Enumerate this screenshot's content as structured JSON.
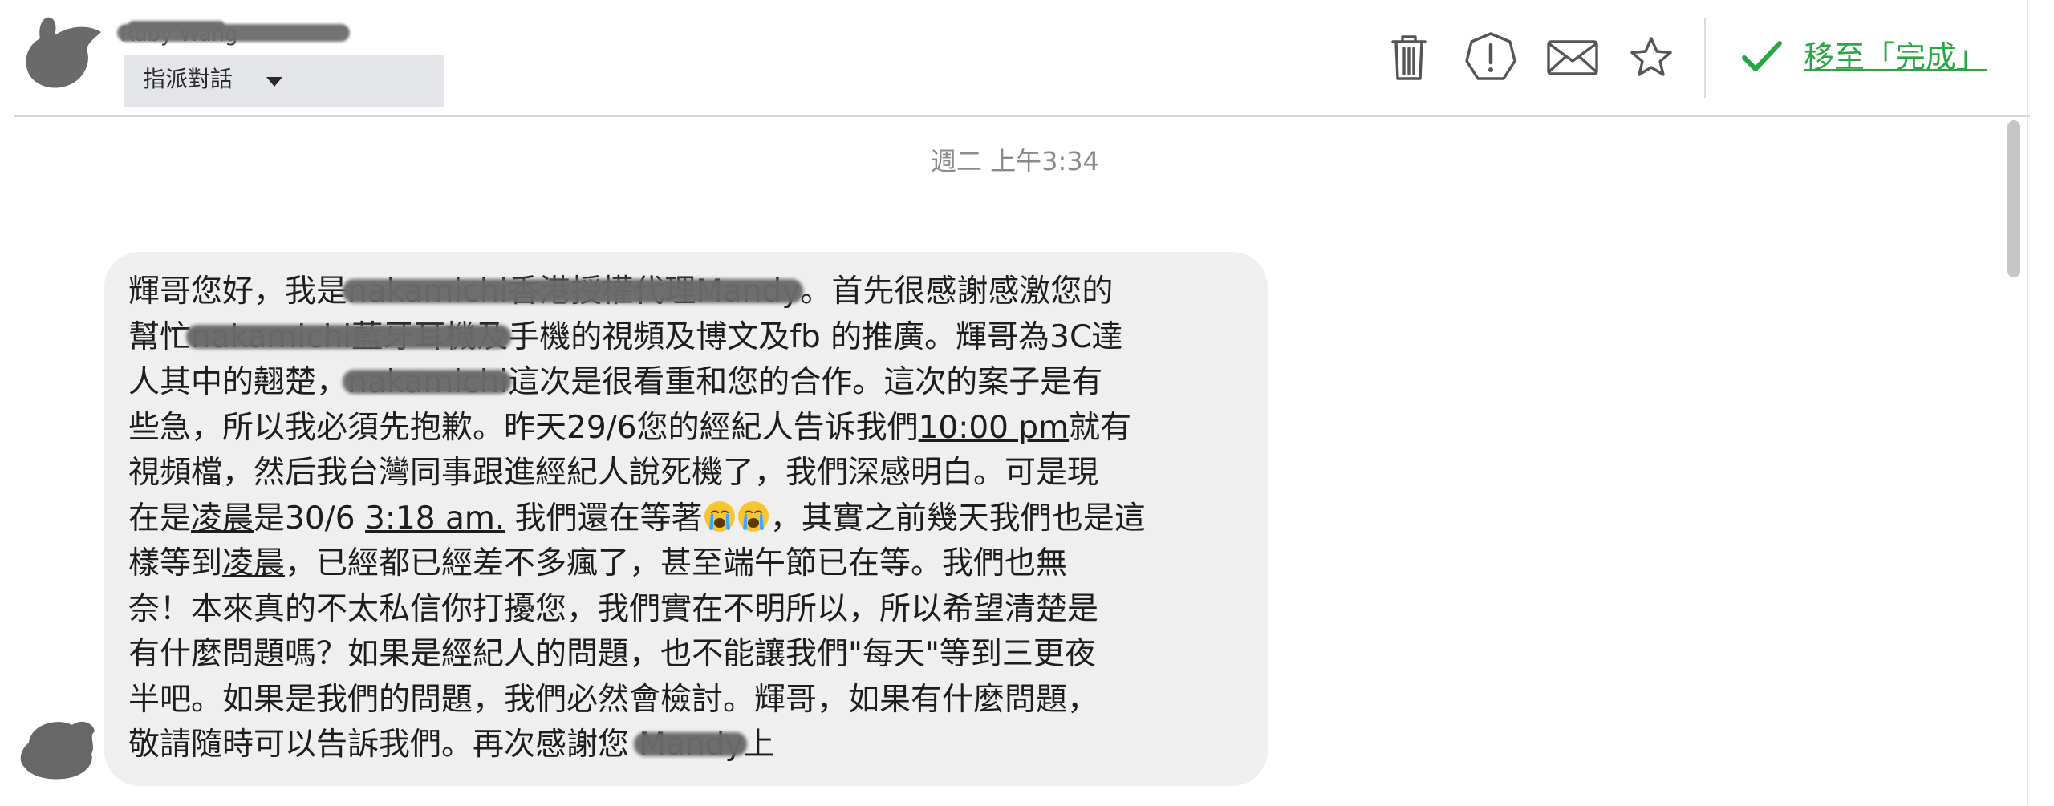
{
  "header": {
    "sender_name": "Ruby Wang",
    "assign_label": "指派對話",
    "actions": {
      "delete_icon": "trash-icon",
      "spam_icon": "exclamation-icon",
      "unread_icon": "envelope-icon",
      "star_icon": "star-icon"
    },
    "done_label": "移至「完成」"
  },
  "thread": {
    "timestamp": "週二 上午3:34",
    "message_lines": [
      [
        {
          "t": "輝哥您好，我是"
        },
        {
          "t": "nakamichi香港授權代理Mandy",
          "r": true
        },
        {
          "t": "。首先很感謝感激您的"
        }
      ],
      [
        {
          "t": "幫忙"
        },
        {
          "t": "nakamichi藍牙耳機及",
          "r": true
        },
        {
          "t": "手機的視頻及博文及fb 的推廣。輝哥為3C達"
        }
      ],
      [
        {
          "t": "人其中的翹楚，"
        },
        {
          "t": "nakamichi",
          "r": true
        },
        {
          "t": "這次是很看重和您的合作。這次的案子是有"
        }
      ],
      [
        {
          "t": "些急，所以我必須先抱歉。昨天29/6您的經紀人告诉我們"
        },
        {
          "t": "10:00 pm",
          "u": true
        },
        {
          "t": "就有"
        }
      ],
      [
        {
          "t": "視頻檔，然后我台灣同事跟進經紀人說死機了，我們深感明白。可是現"
        }
      ],
      [
        {
          "t": "在是"
        },
        {
          "t": "凌晨",
          "u": true
        },
        {
          "t": "是30/6 "
        },
        {
          "t": "3:18 am.",
          "u": true
        },
        {
          "t": " 我們還在等著"
        },
        {
          "e": "crying-face"
        },
        {
          "e": "crying-face"
        },
        {
          "t": "，其實之前幾天我們也是這"
        }
      ],
      [
        {
          "t": "樣等到"
        },
        {
          "t": "凌晨",
          "u": true
        },
        {
          "t": "，已經都已經差不多瘋了，甚至端午節已在等。我們也無"
        }
      ],
      [
        {
          "t": "奈！本來真的不太私信你打擾您，我們實在不明所以，所以希望清楚是"
        }
      ],
      [
        {
          "t": "有什麼問題嗎？如果是經紀人的問題，也不能讓我們\"每天\"等到三更夜"
        }
      ],
      [
        {
          "t": "半吧。如果是我們的問題，我們必然會檢討。輝哥，如果有什麼問題，"
        }
      ],
      [
        {
          "t": "敬請隨時可以告訴我們。再次感謝您 "
        },
        {
          "t": "Mandy",
          "r": true
        },
        {
          "t": "上"
        }
      ]
    ]
  },
  "colors": {
    "done_green": "#28a745",
    "bubble_bg": "#efefef",
    "assign_bg": "#e3e5e8",
    "icon_gray": "#555555"
  }
}
